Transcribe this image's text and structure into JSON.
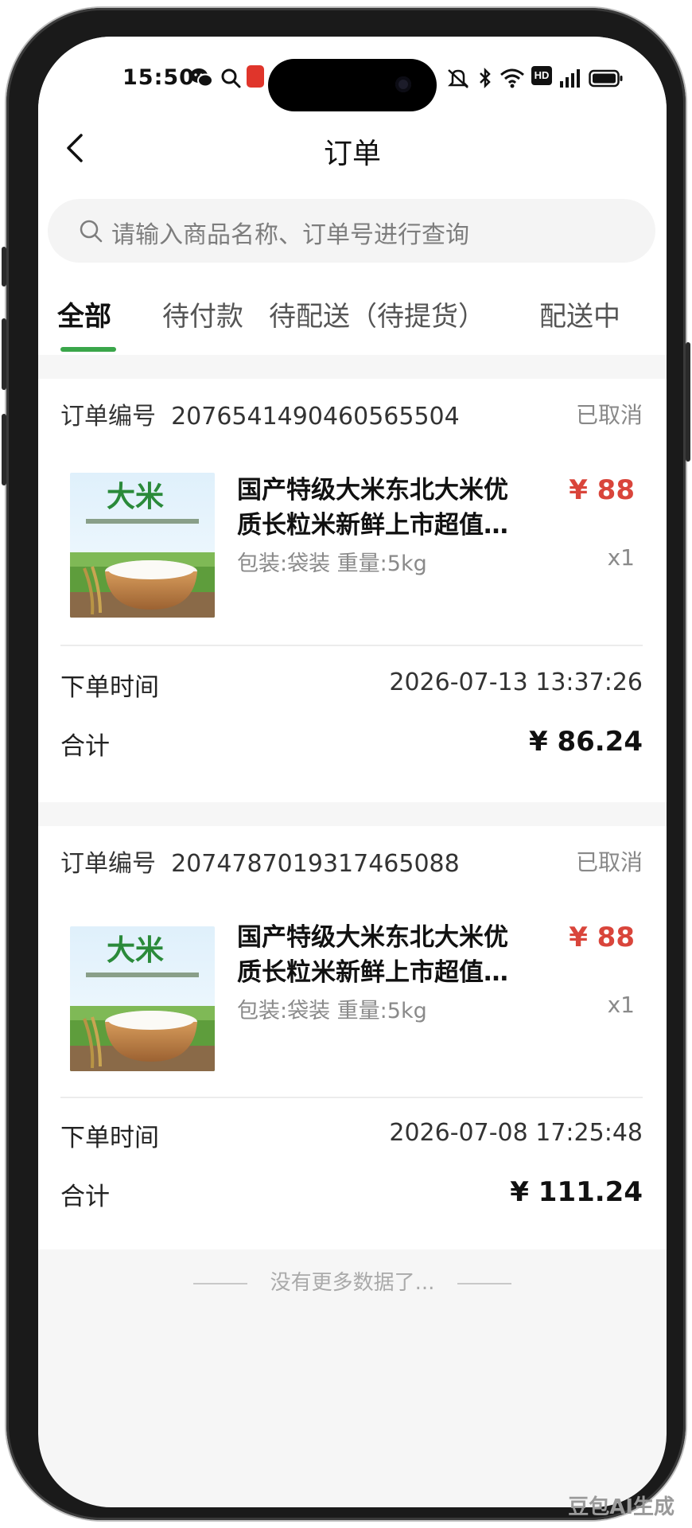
{
  "status_bar": {
    "time": "15:50",
    "network_badge": "HD"
  },
  "header": {
    "title": "订单"
  },
  "search": {
    "placeholder": "请输入商品名称、订单号进行查询"
  },
  "tabs": [
    {
      "label": "全部",
      "active": true
    },
    {
      "label": "待付款",
      "active": false
    },
    {
      "label": "待配送（待提货）",
      "active": false
    },
    {
      "label": "配送中",
      "active": false
    }
  ],
  "orders": [
    {
      "order_no_label": "订单编号",
      "order_no": "2076541490460565504",
      "status": "已取消",
      "product_name_line1": "国产特级大米东北大米优",
      "product_name_line2": "质长粒米新鲜上市超值…",
      "image_title": "大米",
      "price": "¥ 88",
      "spec": "包装:袋装 重量:5kg",
      "qty": "x1",
      "time_label": "下单时间",
      "order_time": "2026-07-13 13:37:26",
      "total_label": "合计",
      "total": "¥ 86.24"
    },
    {
      "order_no_label": "订单编号",
      "order_no": "2074787019317465088",
      "status": "已取消",
      "product_name_line1": "国产特级大米东北大米优",
      "product_name_line2": "质长粒米新鲜上市超值…",
      "image_title": "大米",
      "price": "¥ 88",
      "spec": "包装:袋装 重量:5kg",
      "qty": "x1",
      "time_label": "下单时间",
      "order_time": "2026-07-08 17:25:48",
      "total_label": "合计",
      "total": "¥ 111.24"
    }
  ],
  "footer": {
    "no_more_text": "没有更多数据了..."
  },
  "watermark": "豆包AI生成",
  "colors": {
    "accent_green": "#3aa64a",
    "price_red": "#d9453b",
    "background": "#f6f6f6"
  },
  "icons": {
    "back": "chevron-left-icon",
    "search": "search-icon"
  }
}
